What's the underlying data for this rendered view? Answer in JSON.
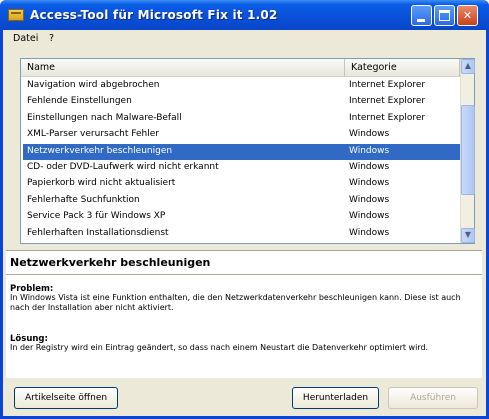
{
  "window": {
    "title": "Access-Tool für Microsoft Fix it 1.02",
    "controls": {
      "minimize_icon": "minimize-icon",
      "maximize_icon": "maximize-icon",
      "close_glyph": "✕"
    }
  },
  "menu": {
    "items": [
      "Datei",
      "?"
    ]
  },
  "list": {
    "columns": [
      "Name",
      "Kategorie"
    ],
    "rows": [
      {
        "name": "Navigation wird abgebrochen",
        "category": "Internet Explorer"
      },
      {
        "name": "Fehlende Einstellungen",
        "category": "Internet Explorer"
      },
      {
        "name": "Einstellungen nach Malware-Befall",
        "category": "Internet Explorer"
      },
      {
        "name": "XML-Parser verursacht Fehler",
        "category": "Windows"
      },
      {
        "name": "Netzwerkverkehr beschleunigen",
        "category": "Windows",
        "selected": true
      },
      {
        "name": "CD- oder DVD-Laufwerk wird nicht erkannt",
        "category": "Windows"
      },
      {
        "name": "Papierkorb wird nicht aktualisiert",
        "category": "Windows"
      },
      {
        "name": "Fehlerhafte Suchfunktion",
        "category": "Windows"
      },
      {
        "name": "Service Pack 3 für Windows XP",
        "category": "Windows"
      },
      {
        "name": "Fehlerhaften Installationsdienst",
        "category": "Windows"
      }
    ]
  },
  "detail": {
    "title": "Netzwerkverkehr beschleunigen",
    "problem_label": "Problem:",
    "problem_text": "In Windows Vista ist eine Funktion enthalten, die den Netzwerkdatenverkehr beschleunigen kann. Diese ist auch nach der Installation aber nicht aktiviert.",
    "solution_label": "Lösung:",
    "solution_text": "In der Registry wird ein Eintrag geändert, so dass nach einem Neustart die Datenverkehr optimiert wird."
  },
  "buttons": {
    "article": "Artikelseite öffnen",
    "restore": "Herunterladen",
    "run": "Ausführen"
  }
}
